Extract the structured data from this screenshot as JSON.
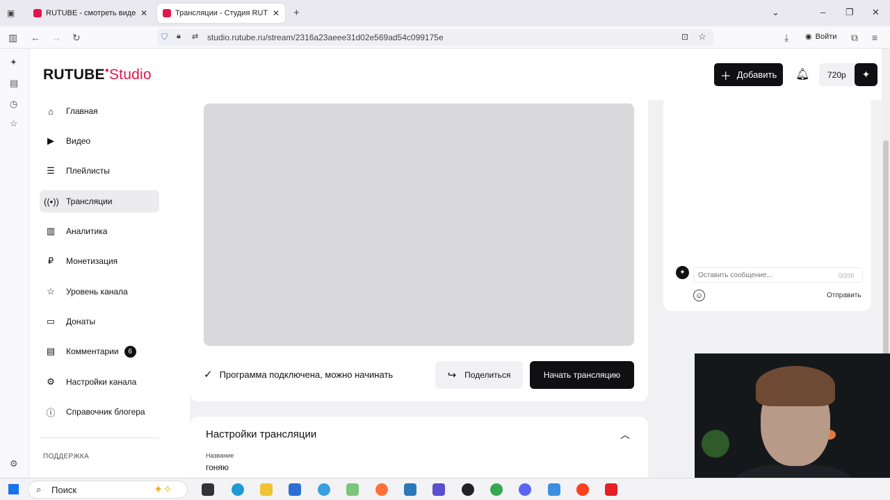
{
  "browser": {
    "tabs": [
      {
        "title": "RUTUBE - смотреть видео онл"
      },
      {
        "title": "Трансляции - Студия RUTUBE"
      }
    ],
    "url": "studio.rutube.ru/stream/2316a23aeee31d02e569ad54c099175e",
    "login_label": "Войти"
  },
  "header": {
    "logo_main": "RUTUBE",
    "logo_sub": "Studio",
    "add_label": "Добавить",
    "quality_label": "720p"
  },
  "sidebar": {
    "items": [
      {
        "label": "Главная",
        "icon": "home-icon"
      },
      {
        "label": "Видео",
        "icon": "video-icon"
      },
      {
        "label": "Плейлисты",
        "icon": "playlist-icon"
      },
      {
        "label": "Трансляции",
        "icon": "broadcast-icon"
      },
      {
        "label": "Аналитика",
        "icon": "analytics-icon"
      },
      {
        "label": "Монетизация",
        "icon": "ruble-icon"
      },
      {
        "label": "Уровень канала",
        "icon": "star-icon"
      },
      {
        "label": "Донаты",
        "icon": "wallet-icon"
      },
      {
        "label": "Комментарии",
        "icon": "comment-icon",
        "badge": "6"
      },
      {
        "label": "Настройки канала",
        "icon": "gear-icon"
      },
      {
        "label": "Справочник блогера",
        "icon": "info-icon"
      }
    ],
    "support_label": "ПОДДЕРЖКА"
  },
  "stream": {
    "status_text": "Программа подключена, можно начинать",
    "share_label": "Поделиться",
    "start_label": "Начать трансляцию"
  },
  "settings": {
    "title": "Настройки трансляции",
    "name_label": "Название",
    "name_value": "гоняю"
  },
  "chat": {
    "placeholder": "Оставить сообщение...",
    "counter": "0/200",
    "send_label": "Отправить"
  },
  "taskbar": {
    "search_label": "Поиск"
  }
}
